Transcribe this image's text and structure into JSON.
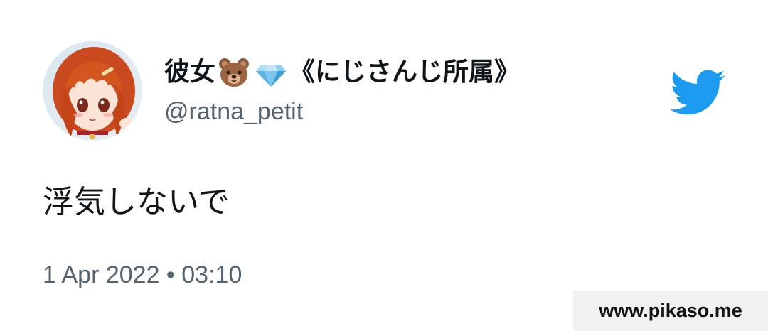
{
  "tweet": {
    "author": {
      "name_before": "彼女",
      "name_after": "《にじさんじ所属》",
      "name_emojis": [
        "bear-face-emoji",
        "gem-stone-emoji"
      ],
      "handle": "@ratna_petit",
      "avatar": "anime-girl-avatar"
    },
    "text": "浮気しないで",
    "timestamp": "1 Apr 2022 • 03:10"
  },
  "brand": {
    "icon": "twitter-bird-icon",
    "color": "#1d9bf0"
  },
  "watermark": {
    "text": "www.pikaso.me"
  },
  "colors": {
    "name_text": "#0f1419",
    "secondary_text": "#536471",
    "watermark_bg": "#f1f1ef"
  }
}
